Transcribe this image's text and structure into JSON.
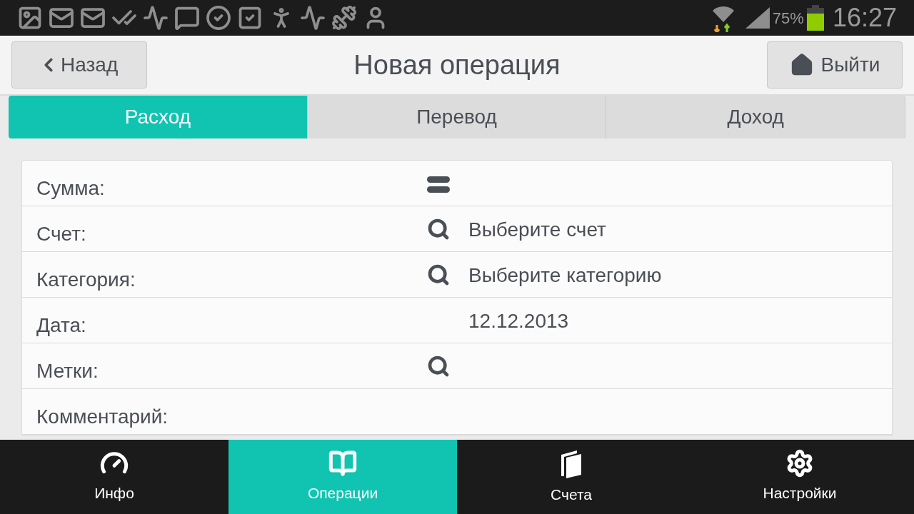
{
  "status_bar": {
    "battery_text": "75%",
    "time": "16:27"
  },
  "header": {
    "back_label": "Назад",
    "title": "Новая операция",
    "exit_label": "Выйти"
  },
  "tabs": [
    {
      "label": "Расход",
      "selected": true
    },
    {
      "label": "Перевод",
      "selected": false
    },
    {
      "label": "Доход",
      "selected": false
    }
  ],
  "form_rows": [
    {
      "label": "Сумма:",
      "kind": "amount"
    },
    {
      "label": "Счет:",
      "kind": "search",
      "value": "Выберите счет"
    },
    {
      "label": "Категория:",
      "kind": "search",
      "value": "Выберите категорию"
    },
    {
      "label": "Дата:",
      "kind": "plain",
      "value": "12.12.2013"
    },
    {
      "label": "Метки:",
      "kind": "search"
    },
    {
      "label": "Комментарий:",
      "kind": "plain"
    }
  ],
  "bottom_nav": [
    {
      "label": "Инфо",
      "kind": "gauge",
      "selected": false
    },
    {
      "label": "Операции",
      "kind": "book",
      "selected": true
    },
    {
      "label": "Счета",
      "kind": "cards",
      "selected": false
    },
    {
      "label": "Настройки",
      "kind": "gear",
      "selected": false
    }
  ]
}
